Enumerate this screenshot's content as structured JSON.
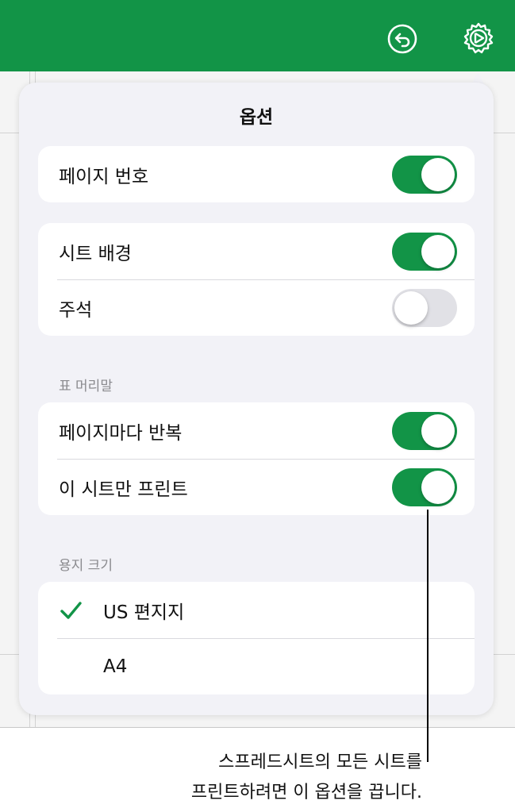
{
  "popover": {
    "title": "옵션",
    "page_numbers": {
      "label": "페이지 번호",
      "on": true
    },
    "sheet_background": {
      "label": "시트 배경",
      "on": true
    },
    "comments": {
      "label": "주석",
      "on": false
    },
    "table_headers": {
      "header": "표 머리말",
      "repeat_on_pages": {
        "label": "페이지마다 반복",
        "on": true
      },
      "print_this_sheet_only": {
        "label": "이 시트만 프린트",
        "on": true
      }
    },
    "paper_size": {
      "header": "용지 크기",
      "options": [
        {
          "label": "US 편지지",
          "selected": true
        },
        {
          "label": "A4",
          "selected": false
        }
      ]
    }
  },
  "callout": {
    "line1": "스프레드시트의 모든 시트를",
    "line2": "프린트하려면 이 옵션을 끕니다."
  },
  "colors": {
    "toolbar_green": "#129447",
    "toggle_on": "#129447",
    "toggle_off": "#e1e1e6",
    "checkmark": "#129447"
  }
}
